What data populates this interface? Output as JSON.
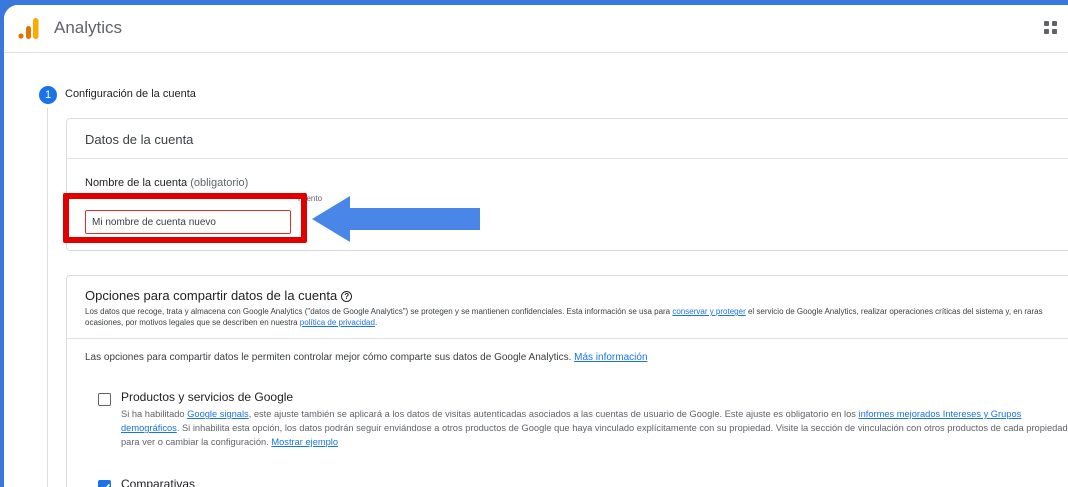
{
  "app": {
    "title": "Analytics"
  },
  "colors": {
    "accent": "#1a73e8",
    "highlight": "#e00000",
    "arrow": "#4a86e8",
    "background": "#3a79dc"
  },
  "step": {
    "number": "1",
    "title": "Configuración de la cuenta"
  },
  "account_card": {
    "title": "Datos de la cuenta",
    "field_label": "Nombre de la cuenta",
    "field_optional": "(obligatorio)",
    "field_hint": "miento",
    "input_value": "Mi nombre de cuenta nuevo"
  },
  "share_card": {
    "title": "Opciones para compartir datos de la cuenta",
    "desc_part1": "Los datos que recoge, trata y almacena con Google Analytics (\"datos de Google Analytics\") se protegen y se mantienen confidenciales. Esta información se usa para ",
    "desc_link1": "conservar y proteger",
    "desc_part2": " el servicio de Google Analytics, realizar operaciones críticas del sistema y, en raras ocasiones, por motivos legales que se describen en nuestra ",
    "desc_link2": "política de privacidad",
    "desc_part3": ".",
    "intro_text": "Las opciones para compartir datos le permiten controlar mejor cómo comparte sus datos de Google Analytics. ",
    "intro_link": "Más información",
    "options": [
      {
        "title": "Productos y servicios de Google",
        "checked": false,
        "desc_part1": "Si ha habilitado ",
        "desc_link1": "Google signals",
        "desc_part2": ", este ajuste también se aplicará a los datos de visitas autenticadas asociados a las cuentas de usuario de Google. Este ajuste es obligatorio en los ",
        "desc_link2": "informes mejorados Intereses y Grupos demográficos",
        "desc_part3": ". Si inhabilita esta opción, los datos podrán seguir enviándose a otros productos de Google que haya vinculado explícitamente con su propiedad. Visite la sección de vinculación con otros productos de cada propiedad para ver o cambiar la configuración. ",
        "desc_link3": "Mostrar ejemplo"
      },
      {
        "title": "Comparativas",
        "checked": true
      }
    ]
  }
}
